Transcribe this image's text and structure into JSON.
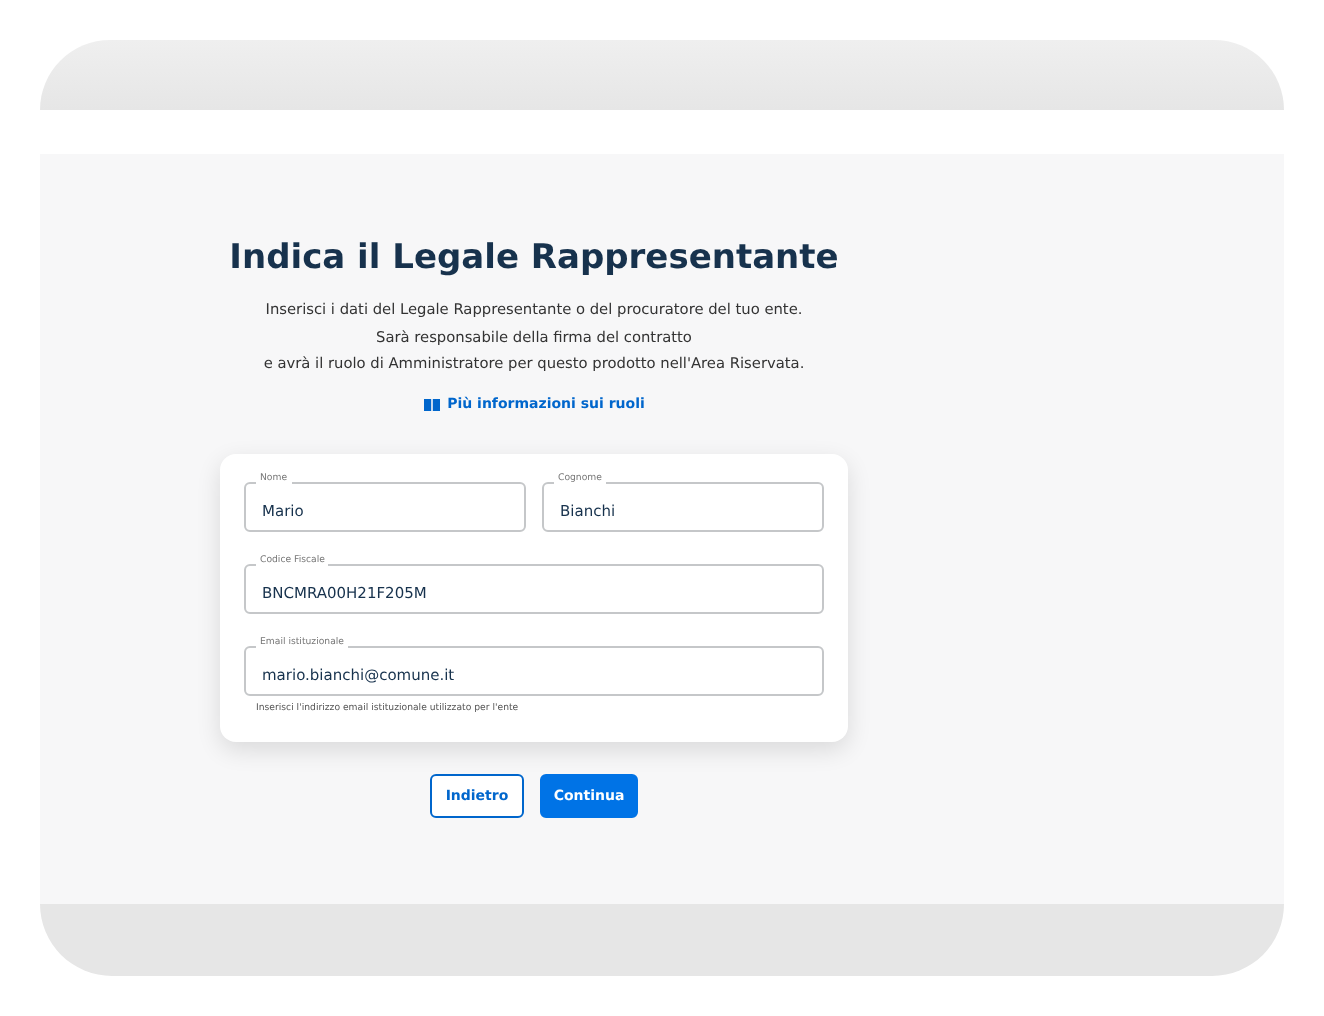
{
  "title": "Indica il Legale Rappresentante",
  "description": [
    "Inserisci i dati del Legale Rappresentante o del procuratore del tuo ente.",
    "Sarà responsabile della firma del contratto",
    "e avrà il ruolo di Amministratore per questo prodotto nell'Area Riservata."
  ],
  "info_link": "Più informazioni sui ruoli",
  "form": {
    "rows": [
      [
        {
          "label": "Nome",
          "value": "Mario"
        },
        {
          "label": "Cognome",
          "value": "Bianchi"
        }
      ],
      [
        {
          "label": "Codice Fiscale",
          "value": "BNCMRA00H21F205M"
        }
      ],
      [
        {
          "label": "Email istituzionale",
          "value": "mario.bianchi@comune.it",
          "helper": "Inserisci l'indirizzo email istituzionale utilizzato per l'ente"
        }
      ]
    ]
  },
  "buttons": [
    {
      "label": "Indietro",
      "kind": "outline"
    },
    {
      "label": "Continua",
      "kind": "primary"
    }
  ]
}
